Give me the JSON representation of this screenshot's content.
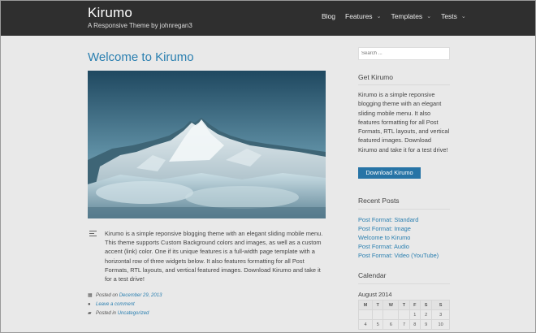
{
  "site": {
    "title": "Kirumo",
    "tagline": "A Responsive Theme by johnregan3"
  },
  "nav": {
    "items": [
      {
        "label": "Blog",
        "dropdown": false
      },
      {
        "label": "Features",
        "dropdown": true
      },
      {
        "label": "Templates",
        "dropdown": true
      },
      {
        "label": "Tests",
        "dropdown": true
      }
    ]
  },
  "post": {
    "title": "Welcome to Kirumo",
    "excerpt": "Kirumo is a simple reponsive blogging theme with an elegant sliding mobile menu. This theme supports Custom Background colors and images, as well as a custom accent (link) color. One if its unique features is a full-width page template with a horizontal row of three widgets below. It also features formatting for all Post Formats, RTL layouts, and vertical featured images. Download Kirumo and take it for a test drive!",
    "meta": {
      "posted_on_label": "Posted on",
      "date": "December 29, 2013",
      "comment_link": "Leave a comment",
      "posted_in_label": "Posted in",
      "category": "Uncategorized"
    }
  },
  "sidebar": {
    "search_placeholder": "Search ...",
    "get_widget": {
      "title": "Get Kirumo",
      "text": "Kirumo is a simple reponsive blogging theme with an elegant sliding mobile menu. It also features formatting for all Post Formats, RTL layouts, and vertical featured images. Download Kirumo and take it for a test drive!",
      "button": "Download Kirumo"
    },
    "recent_posts": {
      "title": "Recent Posts",
      "items": [
        "Post Format: Standard",
        "Post Format: Image",
        "Welcome to Kirumo",
        "Post Format: Audio",
        "Post Format: Video (YouTube)"
      ]
    },
    "calendar": {
      "title": "Calendar",
      "caption": "August 2014",
      "days": [
        "M",
        "T",
        "W",
        "T",
        "F",
        "S",
        "S"
      ],
      "weeks": [
        [
          "",
          "",
          "",
          "",
          "1",
          "2",
          "3"
        ],
        [
          "4",
          "5",
          "6",
          "7",
          "8",
          "9",
          "10"
        ]
      ]
    }
  },
  "colors": {
    "header_bg": "#2f2f2f",
    "accent": "#2a7fb0",
    "button_bg": "#2774a6",
    "page_bg": "#e9e9e9"
  }
}
